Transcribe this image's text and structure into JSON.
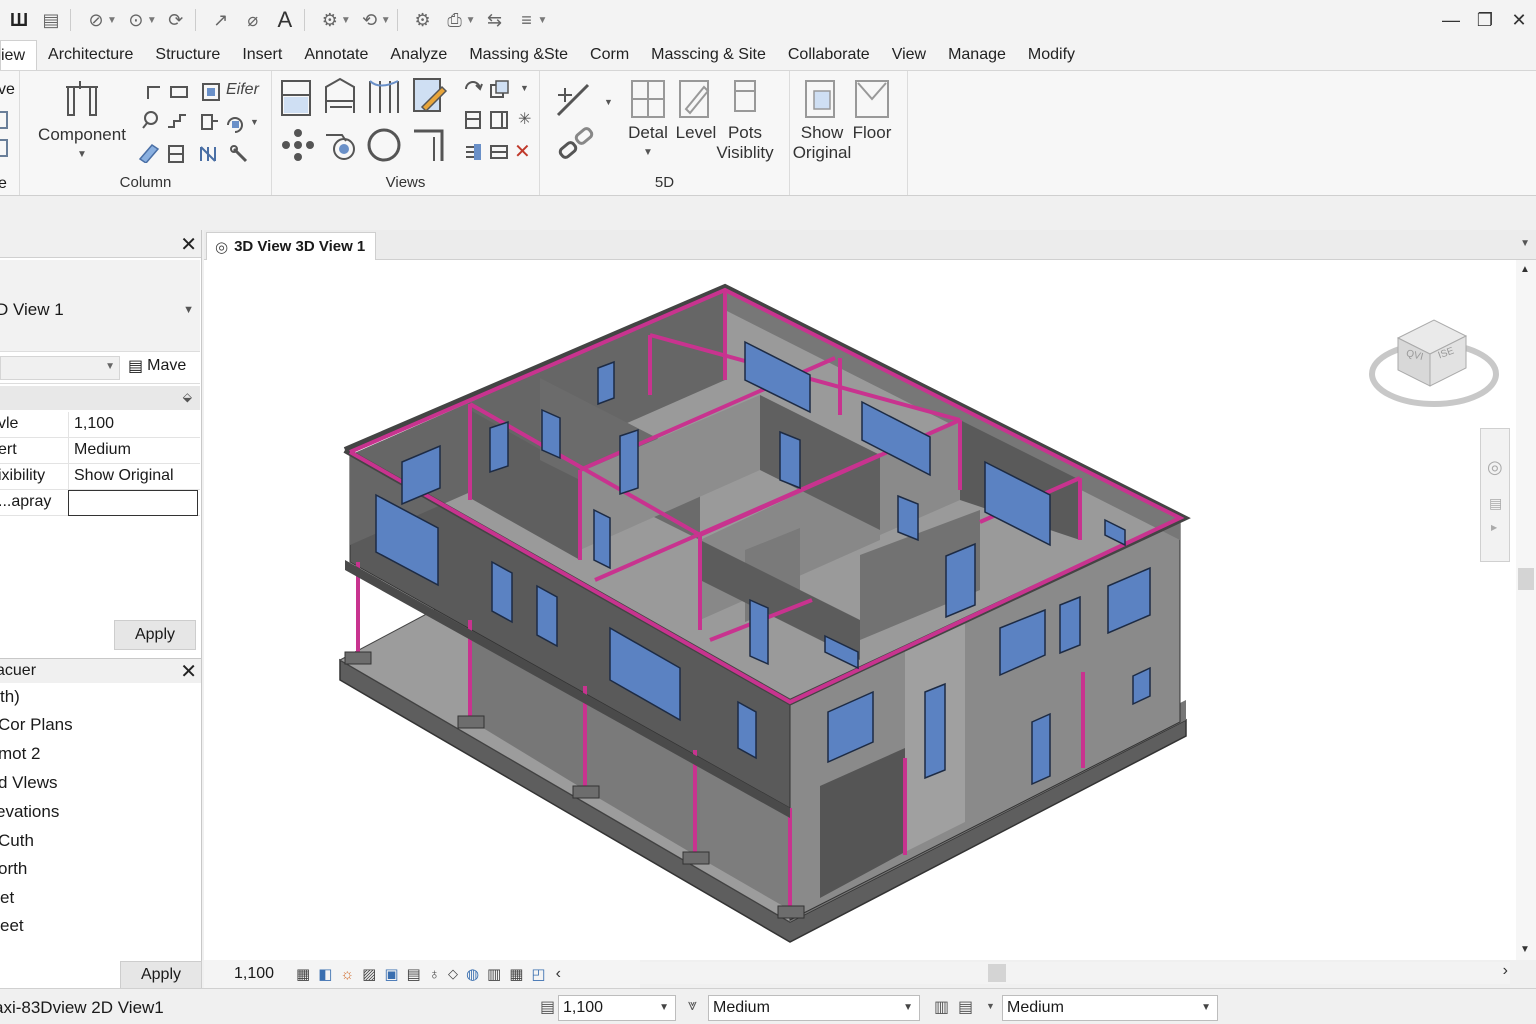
{
  "quick_access": {
    "icons": [
      "app-logo-icon",
      "save-icon",
      "undo-icon",
      "redo-icon",
      "sync-icon",
      "measure-icon",
      "dimension-icon",
      "text-icon",
      "settings-icon",
      "sync2-icon",
      "gear-icon",
      "print-icon",
      "switch-icon",
      "thin-lines-icon"
    ]
  },
  "window": {
    "minimize": "—",
    "maximize": "❐",
    "close": "✕"
  },
  "ribbon_tabs": [
    "iew",
    "Architecture",
    "Structure",
    "Insert",
    "Annotate",
    "Analyze",
    "Massing &Ste",
    "Corm",
    "Masscing & Site",
    "Collaborate",
    "View",
    "Manage",
    "Modify"
  ],
  "ribbon": {
    "left_partial": [
      "ve",
      "",
      "",
      "e"
    ],
    "column_panel": {
      "label": "Column",
      "component_label": "Component",
      "eifer_label": "Eifer"
    },
    "views_panel": {
      "label": "Views"
    },
    "fived_panel": {
      "label": "5D",
      "detail_label": "Detal",
      "level_label": "Level",
      "pots_label": "Pots\nVisiblity"
    },
    "show_panel": {
      "show_original_label": "Show\nOriginal",
      "floor_label": "Floor"
    }
  },
  "properties": {
    "type_name": "D View 1",
    "edit_type": "Mave",
    "rows": [
      {
        "name": "Scale",
        "value": "1,100"
      },
      {
        "name": "Detail Level",
        "value": "Medium"
      },
      {
        "name": "Visibility",
        "value": "Show Original"
      },
      {
        "name": "Display...",
        "value": ""
      }
    ],
    "row_labels_shown": [
      "vle",
      "ert",
      "ixibility",
      "apray..."
    ],
    "apply": "Apply"
  },
  "browser": {
    "title": "acuer",
    "items": [
      "th)",
      "Cor Plans",
      "mot 2",
      "d Vlews",
      "evations",
      "Cuth",
      "orth",
      "et",
      "eet"
    ],
    "apply": "Apply"
  },
  "view": {
    "tab_label": "3D View  3D View 1",
    "scale": "1,100",
    "viewcube_labels": [
      "QVI",
      "ISE"
    ]
  },
  "status": {
    "text": "axi-83Dview 2D View1",
    "scale_value": "1,100",
    "detail_value": "Medium",
    "visual_value": "Medium"
  },
  "colors": {
    "accent_magenta": "#c8338f",
    "wall_gray": "#6a6a6a",
    "window_blue": "#5b82c2"
  }
}
